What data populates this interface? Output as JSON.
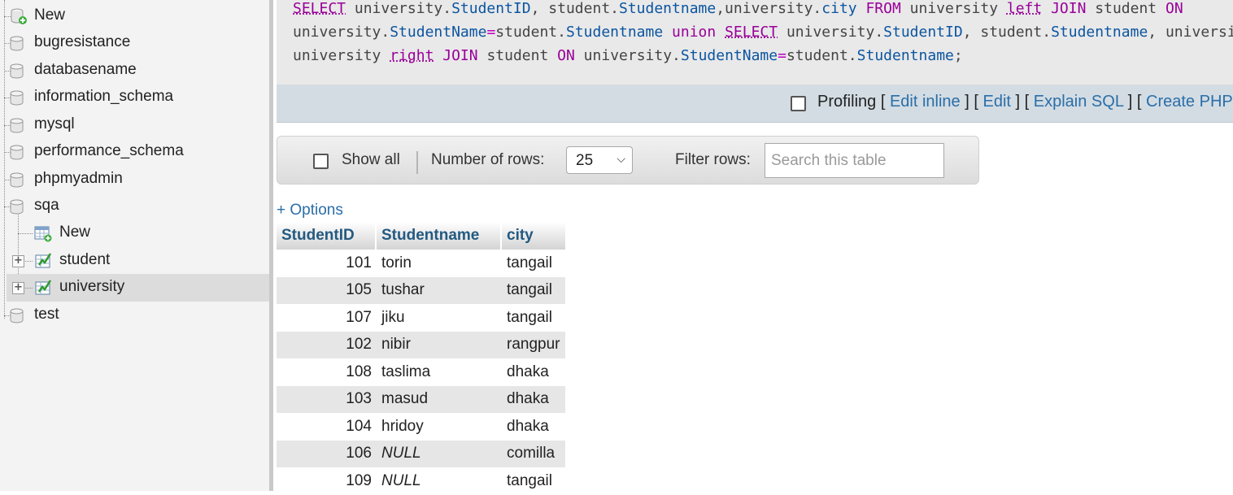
{
  "nav": {
    "items": [
      {
        "label": "New",
        "type": "new"
      },
      {
        "label": "bugresistance",
        "type": "db"
      },
      {
        "label": "databasename",
        "type": "db"
      },
      {
        "label": "information_schema",
        "type": "db"
      },
      {
        "label": "mysql",
        "type": "db"
      },
      {
        "label": "performance_schema",
        "type": "db"
      },
      {
        "label": "phpmyadmin",
        "type": "db"
      },
      {
        "label": "sqa",
        "type": "db"
      },
      {
        "label": "New",
        "type": "new-table"
      },
      {
        "label": "student",
        "type": "table"
      },
      {
        "label": "university",
        "type": "table",
        "selected": true
      },
      {
        "label": "test",
        "type": "db"
      }
    ]
  },
  "sql": {
    "line1": [
      "SELECT",
      " university.",
      "StudentID",
      ", student.",
      "Studentname",
      ",university.",
      "city",
      " ",
      "FROM",
      " university ",
      "left",
      " ",
      "JOIN",
      " student ",
      "ON"
    ],
    "line2": [
      "university.",
      "StudentName",
      "=",
      "student.",
      "Studentname",
      " ",
      "union",
      " ",
      "SELECT",
      " university.",
      "StudentID",
      ", student.",
      "Studentname",
      ", universi"
    ],
    "line3": [
      "university ",
      "right",
      " ",
      "JOIN",
      " student ",
      "ON",
      " university.",
      "StudentName",
      "=",
      "student.",
      "Studentname",
      ";"
    ]
  },
  "query_tools": {
    "profiling_label": "Profiling",
    "open_bracket": "[",
    "close_bracket": "]",
    "edit_inline": "Edit inline",
    "edit": "Edit",
    "explain_sql": "Explain SQL",
    "create_php": "Create PHP c"
  },
  "navbar": {
    "show_all_label": "Show all",
    "rows_label": "Number of rows:",
    "rows_value": "25",
    "filter_label": "Filter rows:",
    "filter_placeholder": "Search this table"
  },
  "options_link": "+ Options",
  "table": {
    "columns": [
      "StudentID",
      "Studentname",
      "city"
    ],
    "rows": [
      [
        "101",
        "torin",
        "tangail"
      ],
      [
        "105",
        "tushar",
        "tangail"
      ],
      [
        "107",
        "jiku",
        "tangail"
      ],
      [
        "102",
        "nibir",
        "rangpur"
      ],
      [
        "108",
        "taslima",
        "dhaka"
      ],
      [
        "103",
        "masud",
        "dhaka"
      ],
      [
        "104",
        "hridoy",
        "dhaka"
      ],
      [
        "106",
        "NULL",
        "comilla"
      ],
      [
        "109",
        "NULL",
        "tangail"
      ]
    ]
  },
  "colors": {
    "keyword": "#990099",
    "field": "#0b55a0",
    "link": "#2a6ea8",
    "header_text": "#235a81"
  }
}
